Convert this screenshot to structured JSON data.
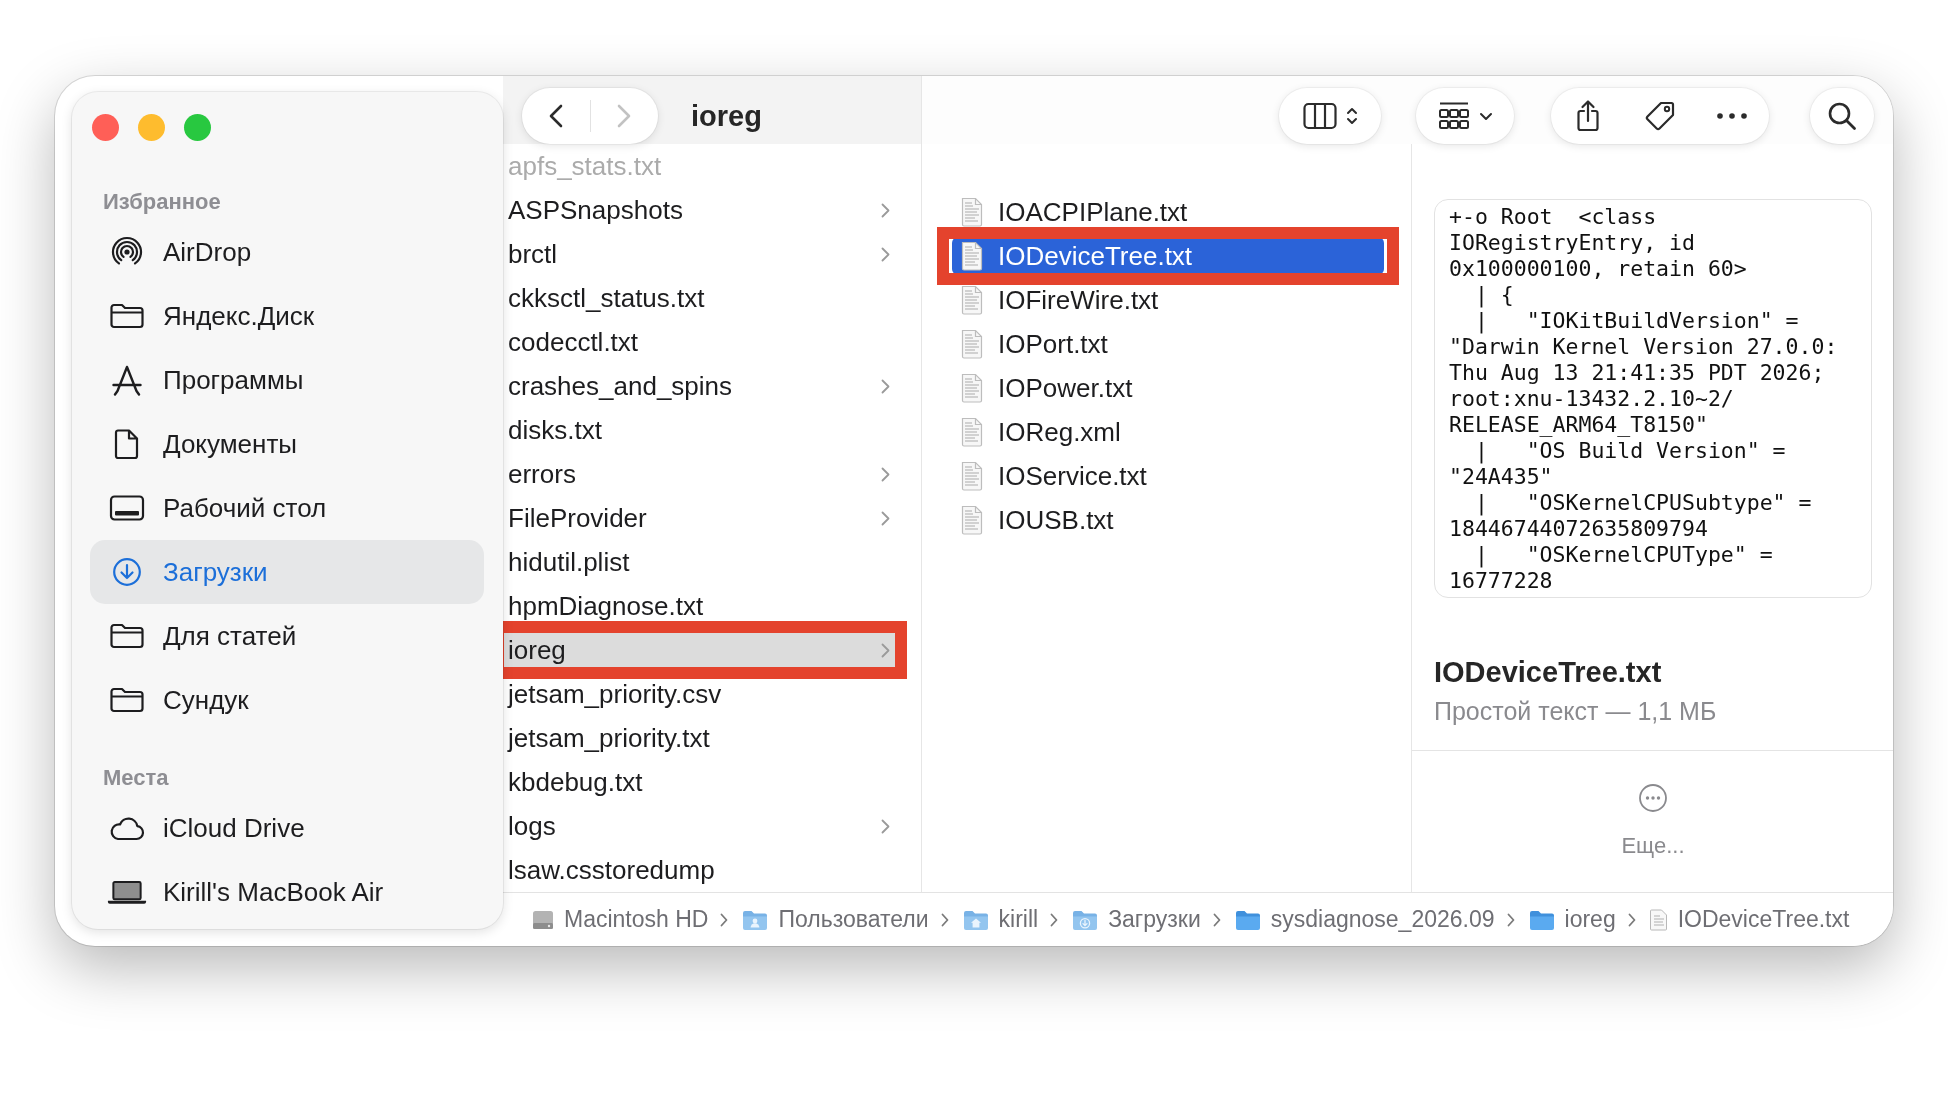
{
  "window": {
    "title": "ioreg",
    "navigation": {
      "back_enabled": true,
      "forward_enabled": false
    }
  },
  "sidebar": {
    "sections": [
      {
        "heading": "Избранное",
        "items": [
          {
            "label": "AirDrop",
            "kind": "airdrop",
            "selected": false
          },
          {
            "label": "Яндекс.Диск",
            "kind": "folder",
            "selected": false
          },
          {
            "label": "Программы",
            "kind": "apps",
            "selected": false
          },
          {
            "label": "Документы",
            "kind": "document",
            "selected": false
          },
          {
            "label": "Рабочий стол",
            "kind": "desktop",
            "selected": false
          },
          {
            "label": "Загрузки",
            "kind": "downloads",
            "selected": true
          },
          {
            "label": "Для статей",
            "kind": "folder",
            "selected": false
          },
          {
            "label": "Сундук",
            "kind": "folder",
            "selected": false
          }
        ]
      },
      {
        "heading": "Места",
        "items": [
          {
            "label": "iCloud Drive",
            "kind": "cloud",
            "selected": false
          },
          {
            "label": "Kirill's MacBook Air",
            "kind": "laptop",
            "selected": false
          }
        ]
      }
    ]
  },
  "parent_column": {
    "items": [
      {
        "name": "apfs_stats.txt",
        "kind": "file",
        "selected": false,
        "dimmed": true,
        "annotated": false
      },
      {
        "name": "ASPSnapshots",
        "kind": "folder",
        "selected": false,
        "dimmed": false,
        "annotated": false
      },
      {
        "name": "brctl",
        "kind": "folder",
        "selected": false,
        "dimmed": false,
        "annotated": false
      },
      {
        "name": "ckksctl_status.txt",
        "kind": "file",
        "selected": false,
        "dimmed": false,
        "annotated": false
      },
      {
        "name": "codecctl.txt",
        "kind": "file",
        "selected": false,
        "dimmed": false,
        "annotated": false
      },
      {
        "name": "crashes_and_spins",
        "kind": "folder",
        "selected": false,
        "dimmed": false,
        "annotated": false
      },
      {
        "name": "disks.txt",
        "kind": "file",
        "selected": false,
        "dimmed": false,
        "annotated": false
      },
      {
        "name": "errors",
        "kind": "folder",
        "selected": false,
        "dimmed": false,
        "annotated": false
      },
      {
        "name": "FileProvider",
        "kind": "folder",
        "selected": false,
        "dimmed": false,
        "annotated": false
      },
      {
        "name": "hidutil.plist",
        "kind": "file",
        "selected": false,
        "dimmed": false,
        "annotated": false
      },
      {
        "name": "hpmDiagnose.txt",
        "kind": "file",
        "selected": false,
        "dimmed": false,
        "annotated": false
      },
      {
        "name": "ioreg",
        "kind": "folder",
        "selected": true,
        "dimmed": false,
        "annotated": true
      },
      {
        "name": "jetsam_priority.csv",
        "kind": "file",
        "selected": false,
        "dimmed": false,
        "annotated": false
      },
      {
        "name": "jetsam_priority.txt",
        "kind": "file",
        "selected": false,
        "dimmed": false,
        "annotated": false
      },
      {
        "name": "kbdebug.txt",
        "kind": "file",
        "selected": false,
        "dimmed": false,
        "annotated": false
      },
      {
        "name": "logs",
        "kind": "folder",
        "selected": false,
        "dimmed": false,
        "annotated": false
      },
      {
        "name": "lsaw.csstoredump",
        "kind": "file",
        "selected": false,
        "dimmed": false,
        "annotated": false
      }
    ]
  },
  "file_column": {
    "items": [
      {
        "name": "IOACPIPlane.txt",
        "selected": false,
        "annotated": false
      },
      {
        "name": "IODeviceTree.txt",
        "selected": true,
        "annotated": true
      },
      {
        "name": "IOFireWire.txt",
        "selected": false,
        "annotated": false
      },
      {
        "name": "IOPort.txt",
        "selected": false,
        "annotated": false
      },
      {
        "name": "IOPower.txt",
        "selected": false,
        "annotated": false
      },
      {
        "name": "IOReg.xml",
        "selected": false,
        "annotated": false
      },
      {
        "name": "IOService.txt",
        "selected": false,
        "annotated": false
      },
      {
        "name": "IOUSB.txt",
        "selected": false,
        "annotated": false
      }
    ]
  },
  "preview": {
    "text_lines": [
      "+-o Root  <class",
      "IORegistryEntry, id",
      "0x100000100, retain 60>",
      "  | {",
      "  |   \"IOKitBuildVersion\" =",
      "\"Darwin Kernel Version 27.0.0:",
      "Thu Aug 13 21:41:35 PDT 2026;",
      "root:xnu-13432.2.10~2/",
      "RELEASE_ARM64_T8150\"",
      "  |   \"OS Build Version\" =",
      "\"24A435\"",
      "  |   \"OSKernelCPUSubtype\" =",
      "18446744072635809794",
      "  |   \"OSKernelCPUType\" =",
      "16777228"
    ],
    "file_name": "IODeviceTree.txt",
    "file_info": "Простой текст — 1,1 МБ",
    "more_label": "Еще..."
  },
  "path_bar": [
    {
      "label": "Macintosh HD",
      "kind": "drive"
    },
    {
      "label": "Пользователи",
      "kind": "users"
    },
    {
      "label": "kirill",
      "kind": "home"
    },
    {
      "label": "Загрузки",
      "kind": "downloads"
    },
    {
      "label": "sysdiagnose_2026.09",
      "kind": "folder"
    },
    {
      "label": "ioreg",
      "kind": "folder"
    },
    {
      "label": "IODeviceTree.txt",
      "kind": "file"
    }
  ]
}
